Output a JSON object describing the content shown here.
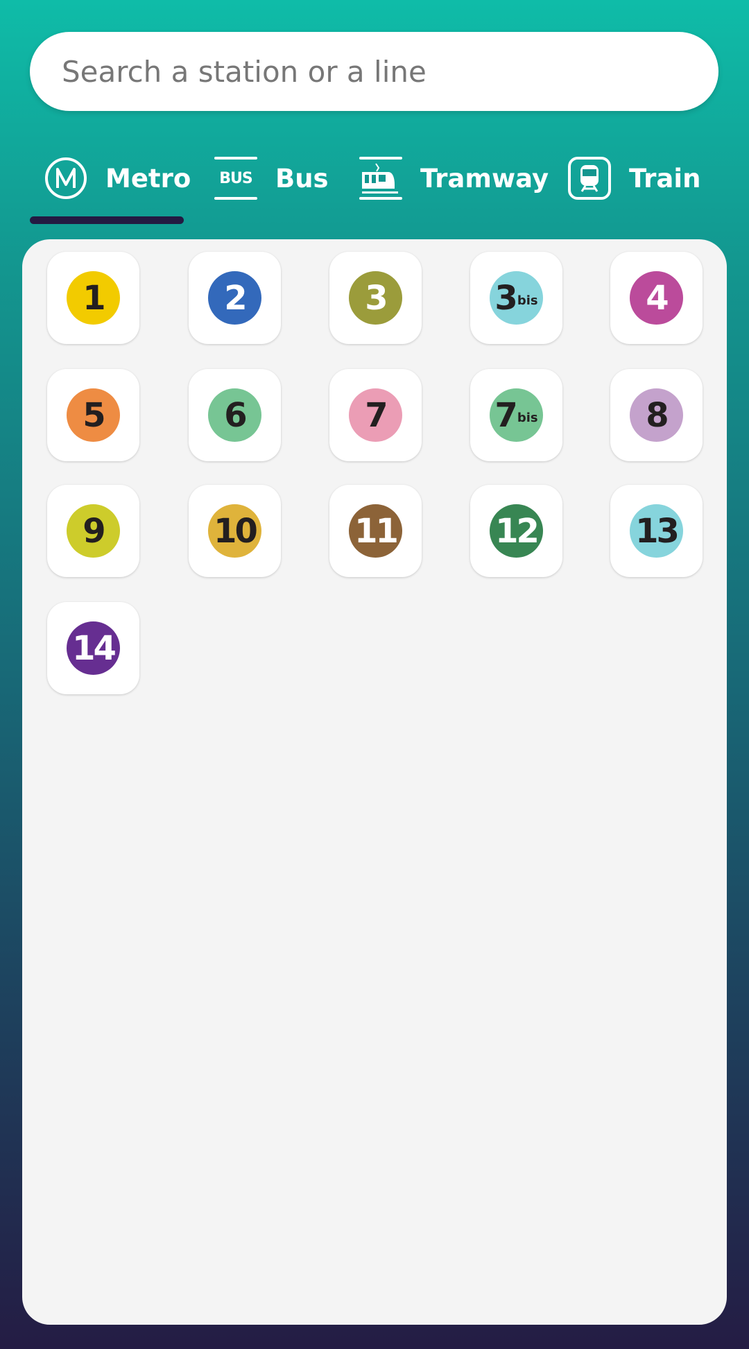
{
  "search": {
    "placeholder": "Search a station or a line"
  },
  "tabs": [
    {
      "label": "Metro",
      "icon": "metro-icon",
      "active": true
    },
    {
      "label": "Bus",
      "icon": "bus-icon",
      "icon_text": "BUS"
    },
    {
      "label": "Tramway",
      "icon": "tramway-icon"
    },
    {
      "label": "Train",
      "icon": "train-icon"
    }
  ],
  "lines": [
    {
      "num": "1",
      "bis": "",
      "color": "#f2cb00",
      "text": "#231f20"
    },
    {
      "num": "2",
      "bis": "",
      "color": "#3369bb",
      "text": "#ffffff"
    },
    {
      "num": "3",
      "bis": "",
      "color": "#9b9c3b",
      "text": "#ffffff"
    },
    {
      "num": "3",
      "bis": "bis",
      "color": "#86d4dc",
      "text": "#231f20"
    },
    {
      "num": "4",
      "bis": "",
      "color": "#bb4b9b",
      "text": "#ffffff"
    },
    {
      "num": "5",
      "bis": "",
      "color": "#ee8c43",
      "text": "#231f20"
    },
    {
      "num": "6",
      "bis": "",
      "color": "#77c594",
      "text": "#231f20"
    },
    {
      "num": "7",
      "bis": "",
      "color": "#eb9db5",
      "text": "#231f20"
    },
    {
      "num": "7",
      "bis": "bis",
      "color": "#77c594",
      "text": "#231f20"
    },
    {
      "num": "8",
      "bis": "",
      "color": "#c4a2cc",
      "text": "#231f20"
    },
    {
      "num": "9",
      "bis": "",
      "color": "#cdcc2b",
      "text": "#231f20"
    },
    {
      "num": "10",
      "bis": "",
      "color": "#dfb33b",
      "text": "#231f20"
    },
    {
      "num": "11",
      "bis": "",
      "color": "#8c6338",
      "text": "#ffffff"
    },
    {
      "num": "12",
      "bis": "",
      "color": "#388653",
      "text": "#ffffff"
    },
    {
      "num": "13",
      "bis": "",
      "color": "#86d4dc",
      "text": "#231f20"
    },
    {
      "num": "14",
      "bis": "",
      "color": "#662e91",
      "text": "#ffffff"
    }
  ]
}
